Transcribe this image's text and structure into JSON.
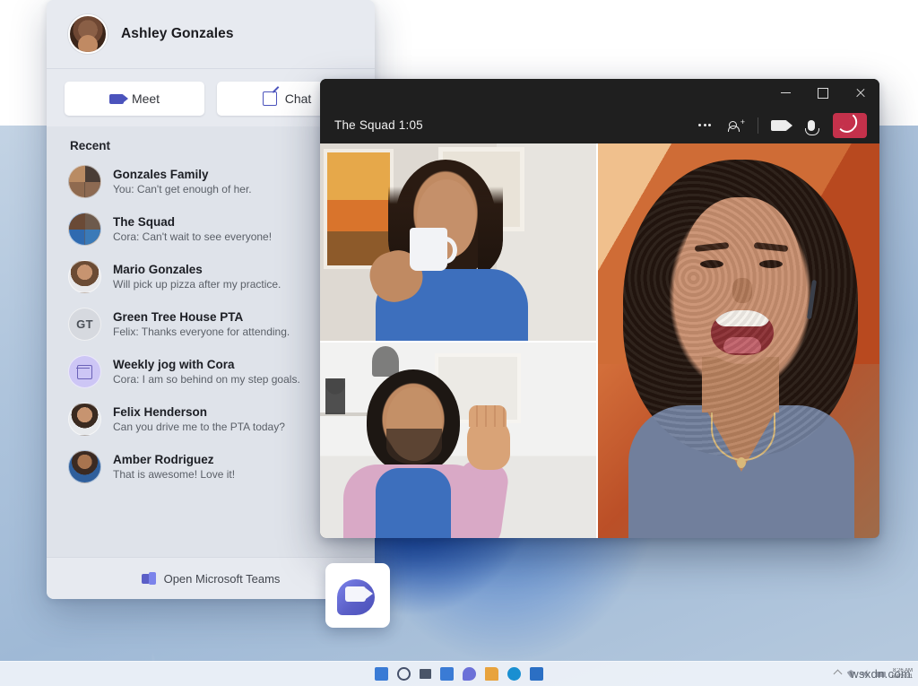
{
  "desktop": {
    "wallpaper_color": "#1b56b8",
    "background_color": "#aec4dc"
  },
  "watermark": {
    "text": "wsxdn.com"
  },
  "taskbar": {
    "icons": [
      {
        "name": "start-icon",
        "label": "Start",
        "color": "#3a7bd5"
      },
      {
        "name": "search-icon",
        "label": "Search",
        "color": "#3e4a5c"
      },
      {
        "name": "task-view-icon",
        "label": "Task view",
        "color": "#4a5568"
      },
      {
        "name": "widgets-icon",
        "label": "Widgets",
        "color": "#3a7bd5"
      },
      {
        "name": "teams-chat-icon",
        "label": "Chat",
        "color": "#5b5fc7"
      },
      {
        "name": "file-explorer-icon",
        "label": "File Explorer",
        "color": "#e8a33d"
      },
      {
        "name": "edge-icon",
        "label": "Microsoft Edge",
        "color": "#1a8fd1"
      },
      {
        "name": "store-icon",
        "label": "Microsoft Store",
        "color": "#2b6fc4"
      }
    ],
    "tray": {
      "chevron": "⌃",
      "wifi": "wifi-icon",
      "volume": "volume-icon",
      "battery": "battery-icon",
      "clock_time": "8:26 AM",
      "clock_date": "6/4/2021"
    }
  },
  "flyout": {
    "profile": {
      "name": "Ashley Gonzales",
      "avatar": "avatar-ashley"
    },
    "actions": [
      {
        "name": "meet-button",
        "label": "Meet",
        "icon": "camera-icon"
      },
      {
        "name": "chat-button",
        "label": "Chat",
        "icon": "compose-icon"
      }
    ],
    "recent_label": "Recent",
    "recent": [
      {
        "title": "Gonzales Family",
        "preview": "You: Can't get enough of her.",
        "avatar": "group-photo",
        "avatar_class": "av-group4",
        "initials": ""
      },
      {
        "title": "The Squad",
        "preview": "Cora: Can't wait to see everyone!",
        "avatar": "group-photo",
        "avatar_class": "av-squad",
        "initials": ""
      },
      {
        "title": "Mario Gonzales",
        "preview": "Will pick up pizza after my practice.",
        "avatar": "person-photo",
        "avatar_class": "av-mario",
        "initials": ""
      },
      {
        "title": "Green Tree House PTA",
        "preview": "Felix: Thanks everyone for attending.",
        "avatar": "initials-badge",
        "avatar_class": "av-initials",
        "initials": "GT"
      },
      {
        "title": "Weekly jog with Cora",
        "preview": "Cora: I am so behind on my step goals.",
        "avatar": "calendar-icon",
        "avatar_class": "av-cal",
        "initials": ""
      },
      {
        "title": "Felix Henderson",
        "preview": "Can you drive me to the PTA today?",
        "avatar": "person-photo",
        "avatar_class": "av-felix",
        "initials": ""
      },
      {
        "title": "Amber Rodriguez",
        "preview": "That is awesome! Love it!",
        "avatar": "person-photo",
        "avatar_class": "av-amber",
        "initials": ""
      }
    ],
    "footer": {
      "label": "Open Microsoft Teams",
      "icon": "teams-logo-icon"
    }
  },
  "call_window": {
    "title": "The Squad 1:05",
    "window_controls": [
      {
        "name": "minimize-button",
        "glyph": "–"
      },
      {
        "name": "maximize-button",
        "glyph": "□"
      },
      {
        "name": "close-button",
        "glyph": "×"
      }
    ],
    "controls": [
      {
        "name": "more-options-button",
        "icon": "ellipsis-icon",
        "label": "More options"
      },
      {
        "name": "add-people-button",
        "icon": "add-people-icon",
        "label": "Add people"
      },
      {
        "name": "camera-toggle-button",
        "icon": "camera-icon",
        "label": "Camera"
      },
      {
        "name": "microphone-toggle-button",
        "icon": "microphone-icon",
        "label": "Microphone"
      },
      {
        "name": "hang-up-button",
        "icon": "phone-hangup-icon",
        "label": "Leave",
        "color": "#c4314b"
      }
    ],
    "participants": [
      {
        "tile": "tile-top-left",
        "description": "Woman drinking from a mug"
      },
      {
        "tile": "tile-bottom-left",
        "description": "Man waving hello"
      },
      {
        "tile": "tile-right-large",
        "description": "Woman laughing"
      }
    ]
  },
  "teams_chat_tile": {
    "name": "teams-chat-app-icon",
    "label": "Chat"
  }
}
